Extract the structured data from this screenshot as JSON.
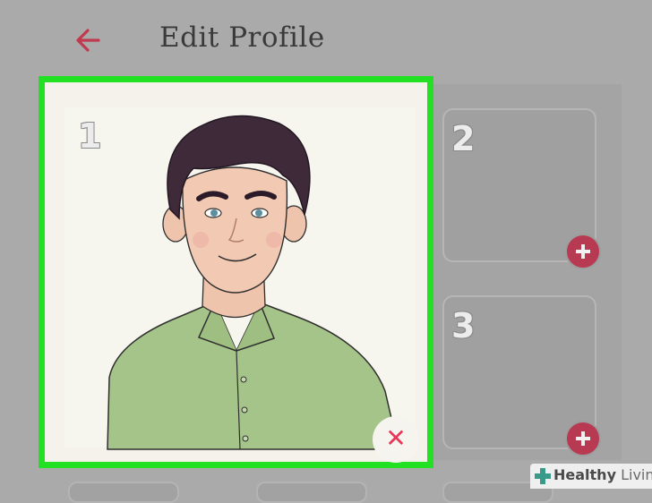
{
  "header": {
    "title": "Edit Profile",
    "back_icon": "arrow-left-icon",
    "accent": "#c0394f"
  },
  "slots": [
    {
      "number": "1",
      "state": "filled",
      "action_icon": "close-icon",
      "highlight": "#22e022"
    },
    {
      "number": "2",
      "state": "empty",
      "action_icon": "plus-icon"
    },
    {
      "number": "3",
      "state": "empty",
      "action_icon": "plus-icon"
    }
  ],
  "watermark": {
    "bold": "Healthy",
    "light": " Living"
  }
}
